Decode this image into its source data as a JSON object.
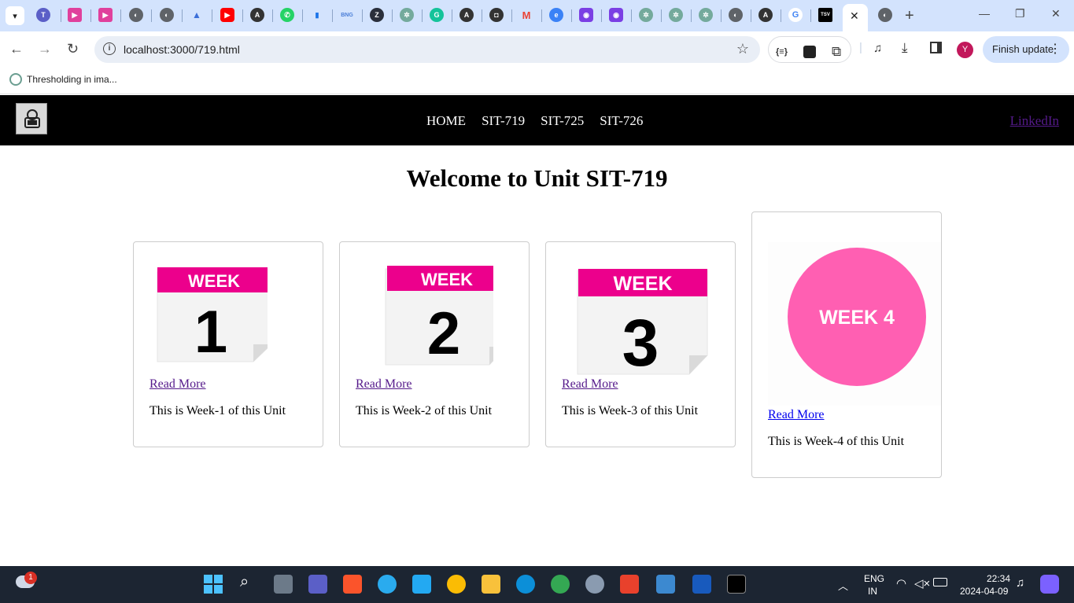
{
  "browser": {
    "active_tab_close": "✕",
    "new_tab": "+",
    "window": {
      "minimize": "—",
      "restore": "❐",
      "close": "✕"
    },
    "url": "localhost:3000/719.html",
    "finish_update_label": "Finish update",
    "profile_initial": "Y",
    "bookmark": "Thresholding in ima..."
  },
  "site": {
    "nav": [
      "HOME",
      "SIT-719",
      "SIT-725",
      "SIT-726"
    ],
    "linkedin": "LinkedIn",
    "heading": "Welcome to Unit SIT-719",
    "cards": [
      {
        "week_word": "WEEK",
        "week_number": "1",
        "read_more": "Read More",
        "description": "This is Week-1 of this Unit"
      },
      {
        "week_word": "WEEK",
        "week_number": "2",
        "read_more": "Read More",
        "description": "This is Week-2 of this Unit"
      },
      {
        "week_word": "WEEK",
        "week_number": "3",
        "read_more": "Read More",
        "description": "This is Week-3 of this Unit"
      },
      {
        "badge": "WEEK 4",
        "read_more": "Read More",
        "description": "This is Week-4 of this Unit"
      }
    ]
  },
  "taskbar": {
    "weather_badge": "1",
    "language_line1": "ENG",
    "language_line2": "IN",
    "time": "22:34",
    "date": "2024-04-09"
  },
  "colors": {
    "week_pink": "#ec008c",
    "week4_circle": "#ff5fb2",
    "navbar": "#000000",
    "tabstrip": "#d3e3fd"
  }
}
